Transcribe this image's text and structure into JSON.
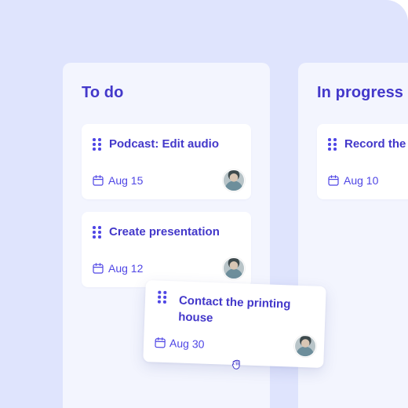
{
  "board": {
    "columns": [
      {
        "title": "To do",
        "cards": [
          {
            "title": "Podcast: Edit audio",
            "date": "Aug 15"
          },
          {
            "title": "Create presentation",
            "date": "Aug 12"
          }
        ]
      },
      {
        "title": "In progress",
        "cards": [
          {
            "title": "Record the",
            "date": "Aug 10"
          }
        ]
      }
    ],
    "dragging_card": {
      "title_line1": "Contact the printing",
      "title_line2": "house",
      "date": "Aug 30"
    }
  },
  "icons": {
    "drag_handle": "grip-dots-icon",
    "calendar": "calendar-icon",
    "cursor": "grab-hand-icon"
  },
  "colors": {
    "background": "#dfe4fd",
    "column": "#f3f5fe",
    "accent": "#4338ca",
    "card": "#ffffff"
  }
}
